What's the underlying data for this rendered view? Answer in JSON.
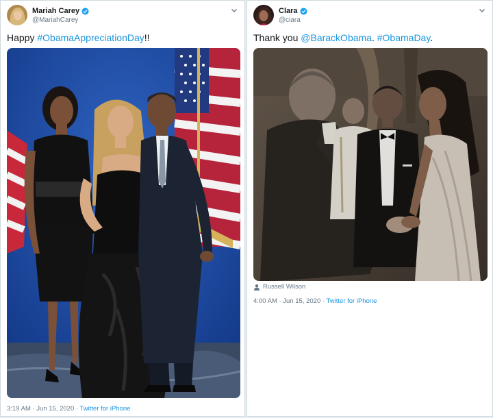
{
  "left_tweet": {
    "display_name": "Mariah Carey",
    "handle": "@MariahCarey",
    "text_prefix": "Happy ",
    "hashtag": "#ObamaAppreciationDay",
    "text_suffix": "!!",
    "timestamp": "3:19 AM · Jun 15, 2020 · ",
    "source": "Twitter for iPhone"
  },
  "right_tweet": {
    "display_name": "Clara",
    "handle": "@ciara",
    "text_prefix": "Thank you ",
    "mention": "@BarackObama",
    "text_middle": ". ",
    "hashtag": "#ObamaDay",
    "text_suffix": ".",
    "photo_tag": "Russell Wilson",
    "timestamp": "4:00 AM · Jun 15, 2020 · ",
    "source": "Twitter for iPhone"
  },
  "colors": {
    "link": "#1b95e0",
    "verified": "#1da1f2",
    "secondary_text": "#657786"
  }
}
